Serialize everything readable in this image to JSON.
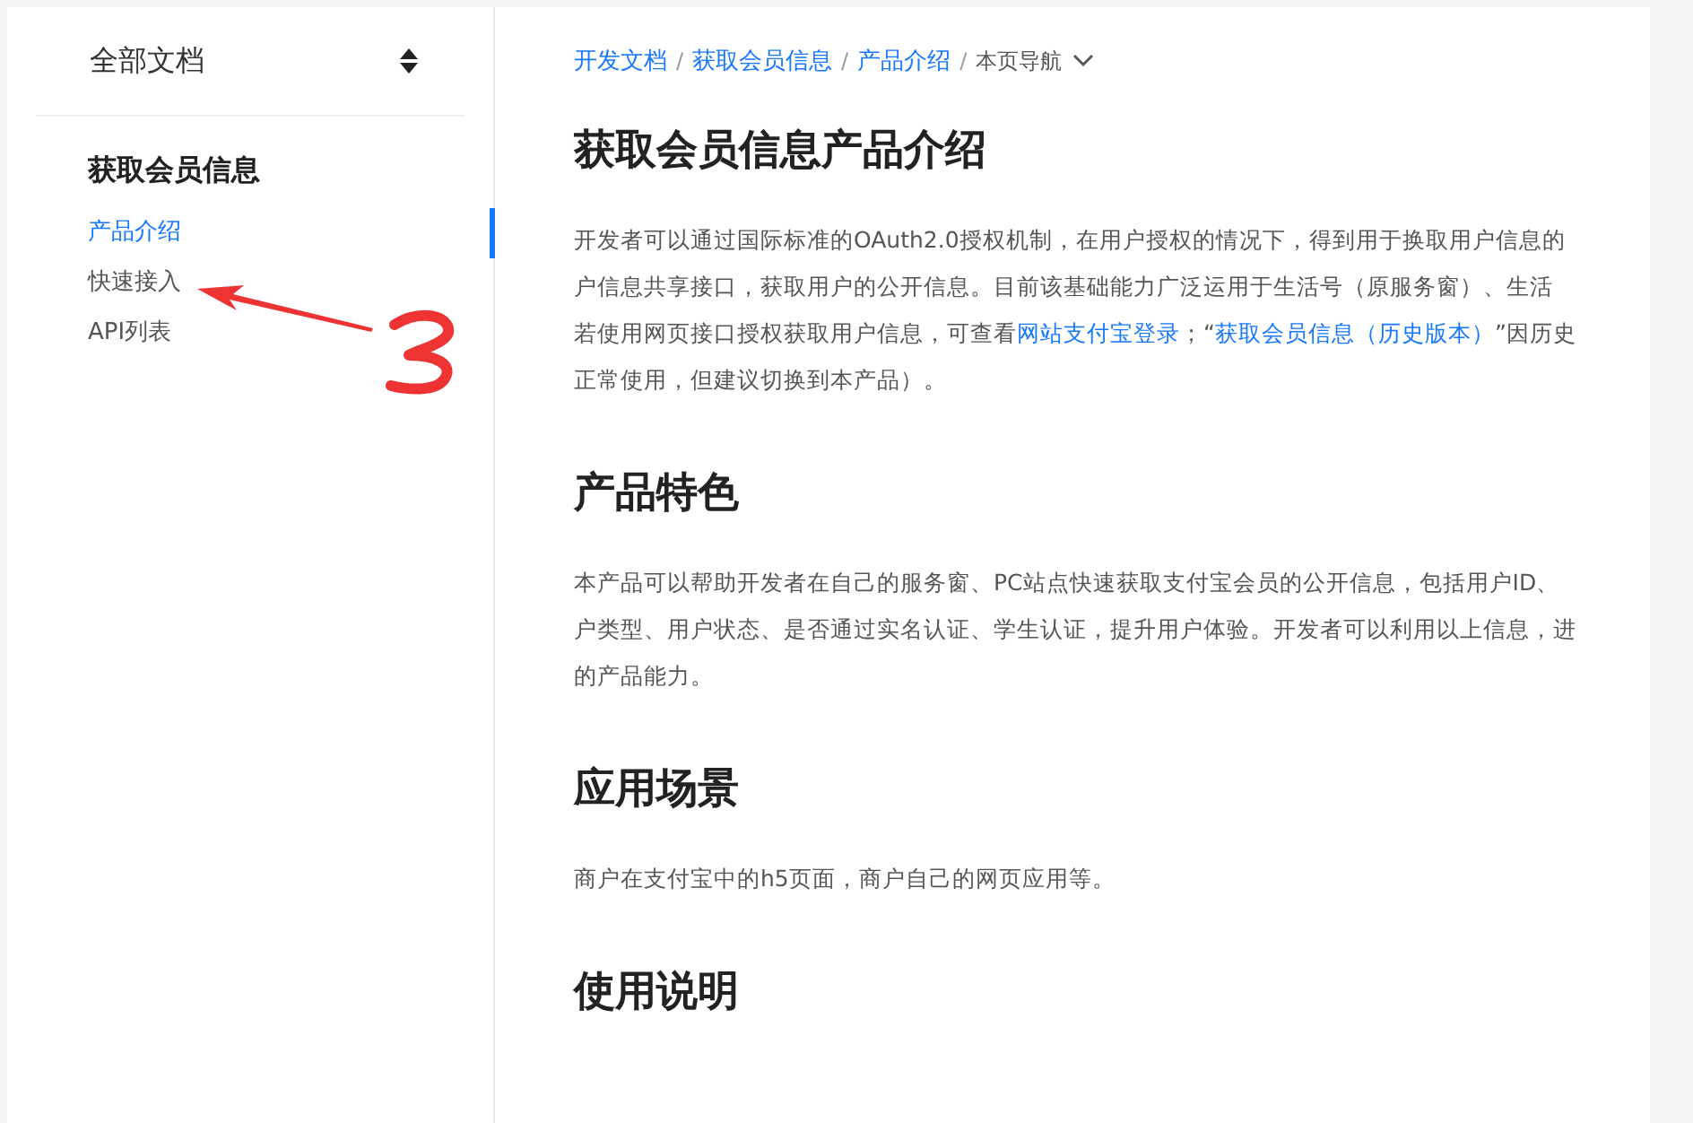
{
  "sidebar": {
    "header": "全部文档",
    "group_title": "获取会员信息",
    "items": [
      {
        "label": "产品介绍",
        "selected": true
      },
      {
        "label": "快速接入",
        "selected": false
      },
      {
        "label": "API列表",
        "selected": false
      }
    ]
  },
  "breadcrumb": [
    {
      "label": "开发文档",
      "kind": "link"
    },
    {
      "separator": "/",
      "label": "获取会员信息",
      "kind": "link"
    },
    {
      "separator": "/",
      "label": "产品介绍",
      "kind": "link"
    },
    {
      "separator": "/",
      "label": "本页导航",
      "kind": "menu"
    }
  ],
  "title": "获取会员信息产品介绍",
  "intro": [
    "开发者可以通过国际标准的OAuth2.0授权机制，在用户授权的情况下，得到用于换取用户信息的",
    "户信息共享接口，获取用户的公开信息。目前该基础能力广泛运用于生活号（原服务窗）、生活",
    [
      {
        "text": "若使用网页接口授权获取用户信息，可查看",
        "kind": "text"
      },
      {
        "text": "网站支付宝登录",
        "kind": "link"
      },
      {
        "text": "；“",
        "kind": "text"
      },
      {
        "text": "获取会员信息（历史版本）",
        "kind": "link"
      },
      {
        "text": "”因历史",
        "kind": "text"
      }
    ],
    "正常使用，但建议切换到本产品）。"
  ],
  "sections": [
    {
      "heading": "产品特色",
      "lines": [
        "本产品可以帮助开发者在自己的服务窗、PC站点快速获取支付宝会员的公开信息，包括用户ID、",
        "户类型、用户状态、是否通过实名认证、学生认证，提升用户体验。开发者可以利用以上信息，进",
        "的产品能力。"
      ]
    },
    {
      "heading": "应用场景",
      "lines": [
        "商户在支付宝中的h5页面，商户自己的网页应用等。"
      ]
    },
    {
      "heading": "使用说明"
    }
  ]
}
